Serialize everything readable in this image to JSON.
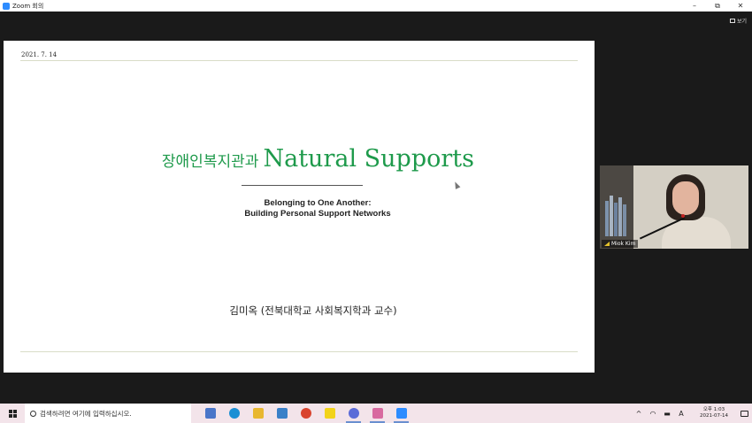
{
  "window": {
    "title": "Zoom 회의",
    "minimize": "–",
    "restore": "⧉",
    "close": "✕"
  },
  "toolbar": {
    "view_label": "보기"
  },
  "slide": {
    "date": "2021. 7. 14",
    "title_korean": "장애인복지관과",
    "title_english": "Natural Supports",
    "subtitle_line1": "Belonging to One Another:",
    "subtitle_line2": "Building Personal Support Networks",
    "author": "김미옥 (전북대학교 사회복지학과 교수)"
  },
  "participant": {
    "name": "Miok Kim"
  },
  "taskbar": {
    "search_placeholder": "검색하려면 여기에 입력하십시오.",
    "apps": [
      {
        "name": "task-view-icon",
        "color": "#4a76c9"
      },
      {
        "name": "edge-icon",
        "color": "#1b8fd4"
      },
      {
        "name": "file-explorer-icon",
        "color": "#e8b730"
      },
      {
        "name": "store-icon",
        "color": "#3a80c8"
      },
      {
        "name": "chrome-icon",
        "color": "#d9442f"
      },
      {
        "name": "kakaotalk-icon",
        "color": "#f2d31a"
      },
      {
        "name": "app-icon",
        "color": "#5b6bd8"
      },
      {
        "name": "flower-app-icon",
        "color": "#d86aa0"
      },
      {
        "name": "zoom-icon",
        "color": "#2d8cff"
      }
    ],
    "tray": {
      "chevron": "^",
      "ime": "A",
      "time": "오후 1:03",
      "date": "2021-07-14"
    }
  }
}
